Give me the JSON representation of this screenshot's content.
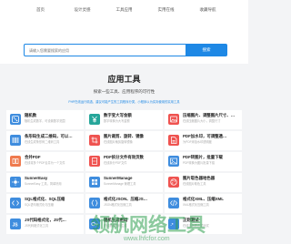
{
  "nav": [
    "首页",
    "设计灵感",
    "工具应用",
    "实用在线",
    "收藏导航"
  ],
  "search": {
    "placeholder": "请输入您需要搜索的应用",
    "button": "搜索"
  },
  "section": {
    "title": "应用工具",
    "subtitle": "探索一些工具、应用程序的可行性",
    "desc": "PHP在线运行精选，建议可能产生的工具程序分类，小程序以为实际使用的实用工具"
  },
  "colors": {
    "blue": "#1e88e5",
    "teal": "#26a69a",
    "red": "#ef5350",
    "orange": "#ff7043"
  },
  "cards": [
    {
      "name": "随机数",
      "desc": "随机生成数字，可设置数字范围",
      "icon": "dice-icon",
      "color": "#3f8dde"
    },
    {
      "name": "数字变大写金额",
      "desc": "数字转换为大写金额",
      "icon": "yen-icon",
      "color": "#26a69a"
    },
    {
      "name": "压缩图片、调整图片尺寸、…",
      "desc": "在线压缩图片大小，调整尺寸",
      "icon": "image-icon",
      "color": "#ef5350"
    },
    {
      "name": "条形码生成二维码，可以…",
      "desc": "在线生成条形码二维码工具",
      "icon": "barcode-icon",
      "color": "#3f8dde"
    },
    {
      "name": "图片裁剪、旋转、镜像",
      "desc": "在线图片裁剪旋转镜像",
      "icon": "crop-icon",
      "color": "#ef5350"
    },
    {
      "name": "PDF加水印，可调整透…",
      "desc": "为PDF添加水印透明度",
      "icon": "pdf-icon",
      "color": "#ef5350"
    },
    {
      "name": "合并PDF",
      "desc": "在线将多个PDF合并为一个文件",
      "icon": "merge-icon",
      "color": "#ef7a4e"
    },
    {
      "name": "PDF拆分文件有效页数",
      "desc": "在线拆分PDF文件",
      "icon": "split-icon",
      "color": "#ef5350"
    },
    {
      "name": "PDF转图片，批量下载",
      "desc": "PDF转换为图片批量下载",
      "icon": "pdf-image-icon",
      "color": "#3f8dde"
    },
    {
      "name": "SunnerEasy",
      "desc": "SunnerEasy 工具，简单好用",
      "icon": "sun-icon",
      "color": "#3f8dde"
    },
    {
      "name": "SunnerManage",
      "desc": "SunnerManage 管理工具",
      "icon": "manage-icon",
      "color": "#3f8dde"
    },
    {
      "name": "图片取色器地色器",
      "desc": "在线图片取色工具",
      "icon": "palette-icon",
      "color": "#ef5350"
    },
    {
      "name": "SQL格式化、SQL压缩",
      "desc": "SQL语句格式化与压缩",
      "icon": "code-icon",
      "color": "#3f8dde"
    },
    {
      "name": "格式化JSON、压缩JS…",
      "desc": "JSON格式化压缩工具",
      "icon": "json-icon",
      "color": "#3f8dde"
    },
    {
      "name": "格式化XML、压缩XML",
      "desc": "XML格式化压缩工具",
      "icon": "xml-icon",
      "color": "#3f8dde"
    },
    {
      "name": "JS代码格式化，JS代…",
      "desc": "JS代码格式化工具",
      "icon": "js-icon",
      "color": "#3f8dde"
    },
    {
      "name": "随机生成密码",
      "desc": "在线随机密码生成",
      "icon": "key-icon",
      "color": "#3f8dde"
    },
    {
      "name": "正则测试",
      "desc": "在线正则表达式测试",
      "icon": "regex-icon",
      "color": "#3f8dde"
    }
  ],
  "watermark": {
    "line1": "领航网络工具",
    "line2": "www.lhfcfor.com"
  }
}
